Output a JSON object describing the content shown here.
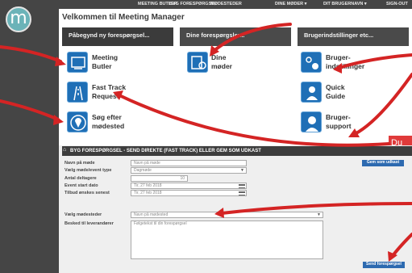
{
  "nav": {
    "meeting_butler": "MEETING BUTLER",
    "byg_forespoergsel": "BYG FORESPØRGSEL",
    "moedesteder": "MØDESTEDER",
    "dine_moeder": "DINE MØDER ▾",
    "dit_brugernavn": "DIT BRUGERNAVN ▾",
    "sign_out": "SIGN-OUT"
  },
  "page_title": "Velkommen til Meeting Manager",
  "top_buttons": {
    "continue_request": "Påbegynd ny forespørgsel...",
    "your_requests": "Dine forespørgsler...",
    "user_settings": "Brugerindstillinger etc..."
  },
  "tiles": {
    "meeting_butler": [
      "Meeting",
      "Butler"
    ],
    "dine_moeder": [
      "Dine",
      "møder"
    ],
    "brugerindstillinger": [
      "Bruger-",
      "indstillinger"
    ],
    "fast_track": [
      "Fast Track",
      "Request"
    ],
    "quick_guide": [
      "Quick",
      "Guide"
    ],
    "soeg_moedested": [
      "Søg efter",
      "mødested"
    ],
    "bruger_support": [
      "Bruger-",
      "support"
    ]
  },
  "callout_text": "Du",
  "form": {
    "header": "BYG FORESPØRGSEL - SEND DIREKTE (FAST TRACK) ELLER GEM SOM UDKAST",
    "labels": {
      "navn": "Navn på møde",
      "type": "Vælg møde/event type",
      "antal": "Antal deltagere",
      "start": "Event start dato",
      "tilbud": "Tilbud ønskes senest",
      "moedesteder": "Vælg mødesteder",
      "besked": "Besked til leverandører"
    },
    "values": {
      "navn_placeholder": "Navn på møde",
      "type_value": "Dagmøde",
      "antal_value": "10",
      "start_value": "Tir, 27 feb 2018",
      "tilbud_value": "Tir, 27 feb 2018",
      "moedested_placeholder": "Navn på mødested",
      "besked_placeholder": "Følgetekst til din forespørgsel"
    },
    "save_draft": "Gem som udkast",
    "send": "Send forespørgsel"
  },
  "colors": {
    "accent_blue": "#1f6fb6",
    "arrow_red": "#d42424",
    "dark_bar": "#454545"
  }
}
